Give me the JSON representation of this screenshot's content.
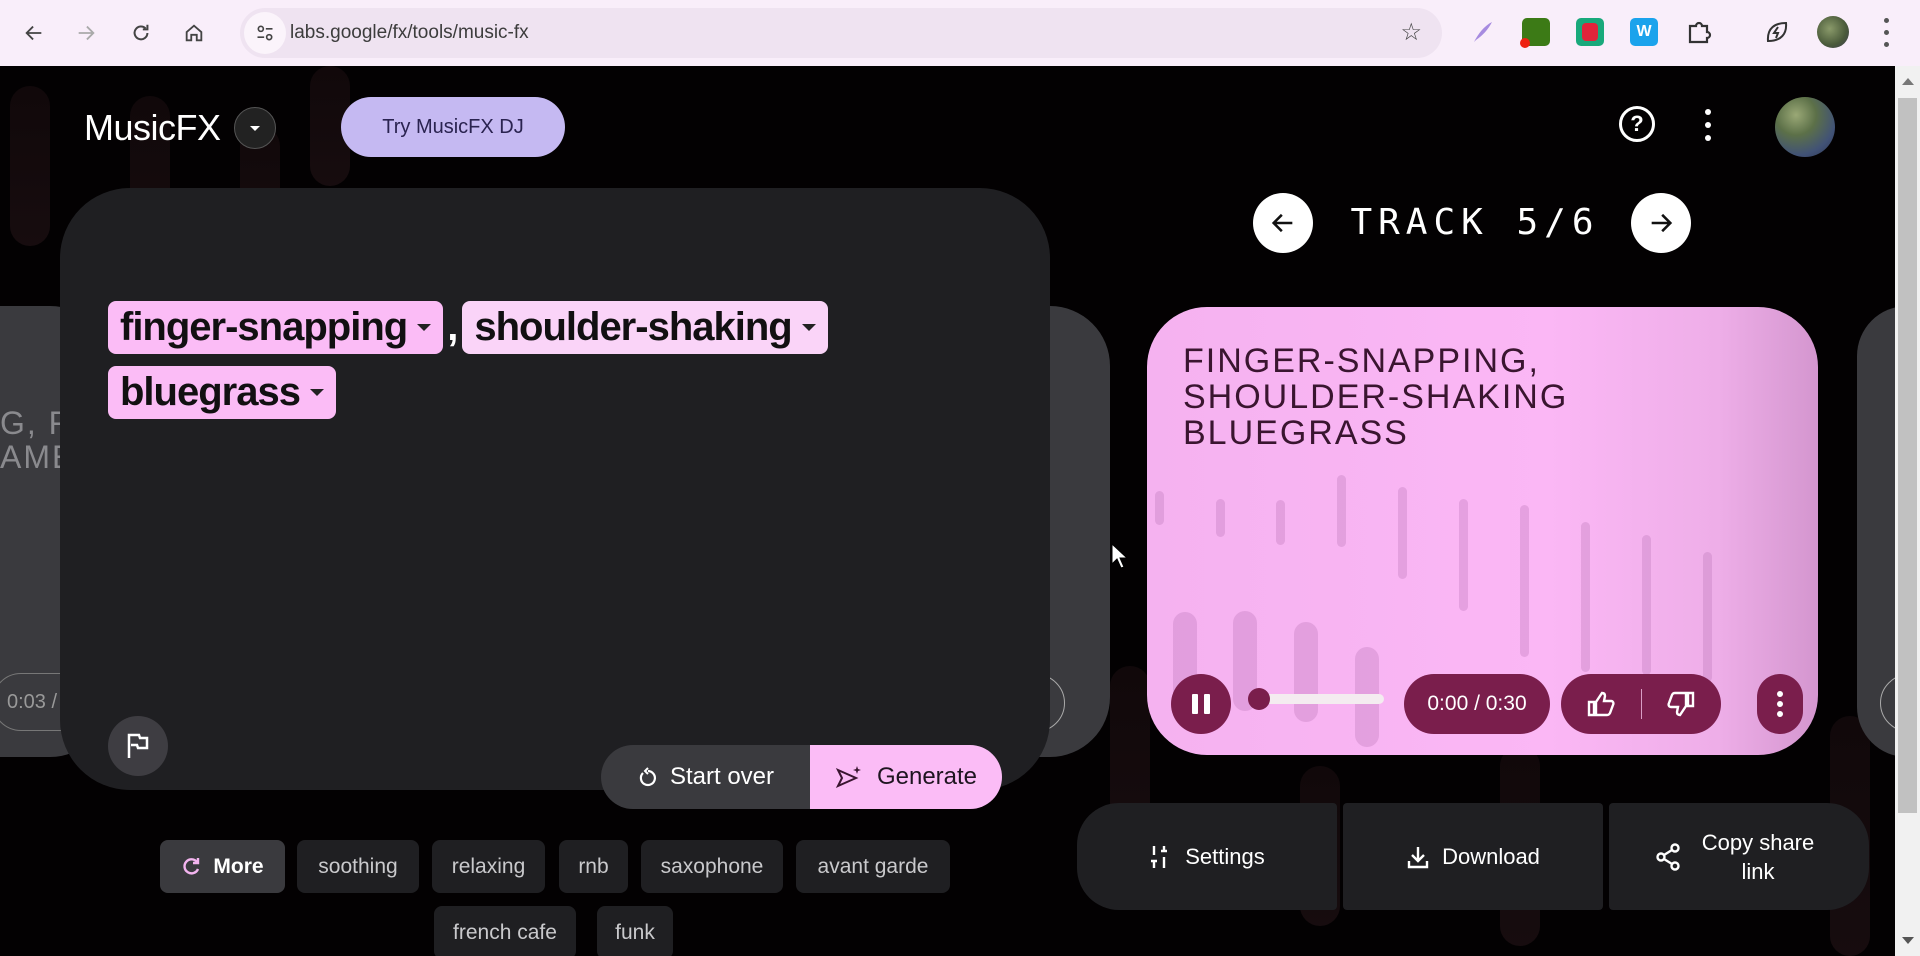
{
  "browser": {
    "url": "labs.google/fx/tools/music-fx",
    "nav": [
      "back",
      "forward",
      "reload",
      "home"
    ],
    "extensions": [
      "quill-extension-icon",
      "green-extension-icon",
      "video-extension-icon",
      "w-extension-icon",
      "puzzle-extension-icon",
      "leaf-bolt-extension-icon"
    ]
  },
  "header": {
    "app_name": "MusicFX",
    "try_dj_label": "Try MusicFX DJ"
  },
  "prompt": {
    "chips": [
      {
        "label": "finger-snapping",
        "separator": ","
      },
      {
        "label": "shoulder-shaking",
        "separator": ""
      },
      {
        "label": "bluegrass",
        "separator": ""
      }
    ],
    "start_over_label": "Start over",
    "generate_label": "Generate"
  },
  "ghost_cards": {
    "left_title_lines": [
      "G, F",
      "AME"
    ],
    "left_time": "0:03 /"
  },
  "track_nav": {
    "label": "TRACK 5/6",
    "current": 5,
    "total": 6
  },
  "track": {
    "title_lines": [
      "FINGER-SNAPPING,",
      "SHOULDER-SHAKING",
      "BLUEGRASS"
    ],
    "state": "playing",
    "time": "0:00 / 0:30",
    "progress": 0.0,
    "accent_color": "#7a1e4c",
    "card_color": "#fbb7f5"
  },
  "actions": {
    "settings_label": "Settings",
    "download_label": "Download",
    "share_label": "Copy share link"
  },
  "suggestions": {
    "more_label": "More",
    "items": [
      "soothing",
      "relaxing",
      "rnb",
      "saxophone",
      "avant garde",
      "french cafe",
      "funk"
    ]
  }
}
